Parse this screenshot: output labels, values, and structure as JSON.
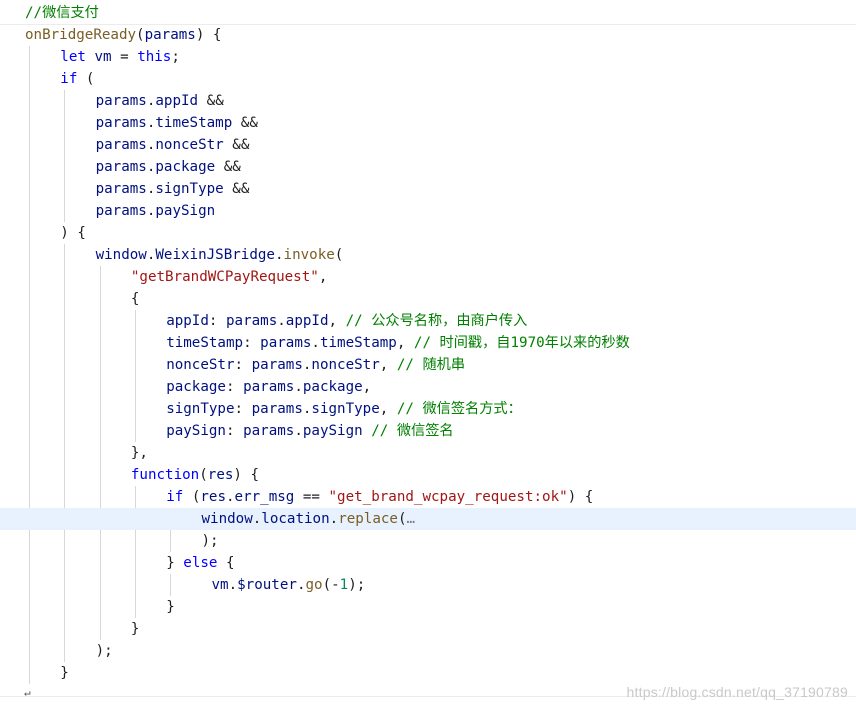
{
  "editor": {
    "colors": {
      "comment": "#008000",
      "keyword": "#0000ff",
      "identifier": "#001080",
      "function": "#795e26",
      "string": "#a31515",
      "number": "#098658",
      "punctuation": "#1e1e1e",
      "highlight_line": "#e8f2fe",
      "indent_guide": "#d7d7d7"
    },
    "lines": [
      {
        "indent": 0,
        "tokens": [
          {
            "text": "//微信支付",
            "type": "comment"
          }
        ]
      },
      {
        "indent": 0,
        "tokens": [
          {
            "text": "onBridgeReady",
            "type": "func"
          },
          {
            "text": "(",
            "type": "punct"
          },
          {
            "text": "params",
            "type": "ident"
          },
          {
            "text": ") {",
            "type": "punct"
          }
        ]
      },
      {
        "indent": 1,
        "tokens": [
          {
            "text": "let",
            "type": "keyword"
          },
          {
            "text": " ",
            "type": "punct"
          },
          {
            "text": "vm",
            "type": "ident"
          },
          {
            "text": " = ",
            "type": "punct"
          },
          {
            "text": "this",
            "type": "keyword"
          },
          {
            "text": ";",
            "type": "punct"
          }
        ]
      },
      {
        "indent": 1,
        "tokens": [
          {
            "text": "if",
            "type": "keyword"
          },
          {
            "text": " (",
            "type": "punct"
          }
        ]
      },
      {
        "indent": 2,
        "tokens": [
          {
            "text": "params",
            "type": "ident"
          },
          {
            "text": ".",
            "type": "punct"
          },
          {
            "text": "appId",
            "type": "ident"
          },
          {
            "text": " &&",
            "type": "punct"
          }
        ]
      },
      {
        "indent": 2,
        "tokens": [
          {
            "text": "params",
            "type": "ident"
          },
          {
            "text": ".",
            "type": "punct"
          },
          {
            "text": "timeStamp",
            "type": "ident"
          },
          {
            "text": " &&",
            "type": "punct"
          }
        ]
      },
      {
        "indent": 2,
        "tokens": [
          {
            "text": "params",
            "type": "ident"
          },
          {
            "text": ".",
            "type": "punct"
          },
          {
            "text": "nonceStr",
            "type": "ident"
          },
          {
            "text": " &&",
            "type": "punct"
          }
        ]
      },
      {
        "indent": 2,
        "tokens": [
          {
            "text": "params",
            "type": "ident"
          },
          {
            "text": ".",
            "type": "punct"
          },
          {
            "text": "package",
            "type": "ident"
          },
          {
            "text": " &&",
            "type": "punct"
          }
        ]
      },
      {
        "indent": 2,
        "tokens": [
          {
            "text": "params",
            "type": "ident"
          },
          {
            "text": ".",
            "type": "punct"
          },
          {
            "text": "signType",
            "type": "ident"
          },
          {
            "text": " &&",
            "type": "punct"
          }
        ]
      },
      {
        "indent": 2,
        "tokens": [
          {
            "text": "params",
            "type": "ident"
          },
          {
            "text": ".",
            "type": "punct"
          },
          {
            "text": "paySign",
            "type": "ident"
          }
        ]
      },
      {
        "indent": 1,
        "tokens": [
          {
            "text": ") {",
            "type": "punct"
          }
        ]
      },
      {
        "indent": 2,
        "tokens": [
          {
            "text": "window",
            "type": "ident"
          },
          {
            "text": ".",
            "type": "punct"
          },
          {
            "text": "WeixinJSBridge",
            "type": "ident"
          },
          {
            "text": ".",
            "type": "punct"
          },
          {
            "text": "invoke",
            "type": "func"
          },
          {
            "text": "(",
            "type": "punct"
          }
        ]
      },
      {
        "indent": 3,
        "tokens": [
          {
            "text": "\"getBrandWCPayRequest\"",
            "type": "string"
          },
          {
            "text": ",",
            "type": "punct"
          }
        ]
      },
      {
        "indent": 3,
        "tokens": [
          {
            "text": "{",
            "type": "punct"
          }
        ]
      },
      {
        "indent": 4,
        "tokens": [
          {
            "text": "appId",
            "type": "ident"
          },
          {
            "text": ": ",
            "type": "punct"
          },
          {
            "text": "params",
            "type": "ident"
          },
          {
            "text": ".",
            "type": "punct"
          },
          {
            "text": "appId",
            "type": "ident"
          },
          {
            "text": ", ",
            "type": "punct"
          },
          {
            "text": "// 公众号名称，由商户传入",
            "type": "comment"
          }
        ]
      },
      {
        "indent": 4,
        "tokens": [
          {
            "text": "timeStamp",
            "type": "ident"
          },
          {
            "text": ": ",
            "type": "punct"
          },
          {
            "text": "params",
            "type": "ident"
          },
          {
            "text": ".",
            "type": "punct"
          },
          {
            "text": "timeStamp",
            "type": "ident"
          },
          {
            "text": ", ",
            "type": "punct"
          },
          {
            "text": "// 时间戳，自1970年以来的秒数",
            "type": "comment"
          }
        ]
      },
      {
        "indent": 4,
        "tokens": [
          {
            "text": "nonceStr",
            "type": "ident"
          },
          {
            "text": ": ",
            "type": "punct"
          },
          {
            "text": "params",
            "type": "ident"
          },
          {
            "text": ".",
            "type": "punct"
          },
          {
            "text": "nonceStr",
            "type": "ident"
          },
          {
            "text": ", ",
            "type": "punct"
          },
          {
            "text": "// 随机串",
            "type": "comment"
          }
        ]
      },
      {
        "indent": 4,
        "tokens": [
          {
            "text": "package",
            "type": "ident"
          },
          {
            "text": ": ",
            "type": "punct"
          },
          {
            "text": "params",
            "type": "ident"
          },
          {
            "text": ".",
            "type": "punct"
          },
          {
            "text": "package",
            "type": "ident"
          },
          {
            "text": ",",
            "type": "punct"
          }
        ]
      },
      {
        "indent": 4,
        "tokens": [
          {
            "text": "signType",
            "type": "ident"
          },
          {
            "text": ": ",
            "type": "punct"
          },
          {
            "text": "params",
            "type": "ident"
          },
          {
            "text": ".",
            "type": "punct"
          },
          {
            "text": "signType",
            "type": "ident"
          },
          {
            "text": ", ",
            "type": "punct"
          },
          {
            "text": "// 微信签名方式：",
            "type": "comment"
          }
        ]
      },
      {
        "indent": 4,
        "tokens": [
          {
            "text": "paySign",
            "type": "ident"
          },
          {
            "text": ": ",
            "type": "punct"
          },
          {
            "text": "params",
            "type": "ident"
          },
          {
            "text": ".",
            "type": "punct"
          },
          {
            "text": "paySign",
            "type": "ident"
          },
          {
            "text": " ",
            "type": "punct"
          },
          {
            "text": "// 微信签名",
            "type": "comment"
          }
        ]
      },
      {
        "indent": 3,
        "tokens": [
          {
            "text": "},",
            "type": "punct"
          }
        ]
      },
      {
        "indent": 3,
        "tokens": [
          {
            "text": "function",
            "type": "keyword"
          },
          {
            "text": "(",
            "type": "punct"
          },
          {
            "text": "res",
            "type": "ident"
          },
          {
            "text": ") {",
            "type": "punct"
          }
        ]
      },
      {
        "indent": 4,
        "tokens": [
          {
            "text": "if",
            "type": "keyword"
          },
          {
            "text": " (",
            "type": "punct"
          },
          {
            "text": "res",
            "type": "ident"
          },
          {
            "text": ".",
            "type": "punct"
          },
          {
            "text": "err_msg",
            "type": "ident"
          },
          {
            "text": " == ",
            "type": "punct"
          },
          {
            "text": "\"get_brand_wcpay_request:ok\"",
            "type": "string"
          },
          {
            "text": ") {",
            "type": "punct"
          }
        ]
      },
      {
        "indent": 5,
        "highlight": true,
        "tokens": [
          {
            "text": "window",
            "type": "ident"
          },
          {
            "text": ".",
            "type": "punct"
          },
          {
            "text": "location",
            "type": "ident"
          },
          {
            "text": ".",
            "type": "punct"
          },
          {
            "text": "replace",
            "type": "func"
          },
          {
            "text": "(",
            "type": "punct"
          },
          {
            "text": "…",
            "type": "ellipsis"
          }
        ]
      },
      {
        "indent": 5,
        "tokens": [
          {
            "text": ");",
            "type": "punct"
          }
        ]
      },
      {
        "indent": 4,
        "tokens": [
          {
            "text": "} ",
            "type": "punct"
          },
          {
            "text": "else",
            "type": "keyword"
          },
          {
            "text": " {",
            "type": "punct"
          }
        ]
      },
      {
        "indent": 5,
        "shift": 1,
        "tokens": [
          {
            "text": "vm",
            "type": "ident"
          },
          {
            "text": ".",
            "type": "punct"
          },
          {
            "text": "$router",
            "type": "ident"
          },
          {
            "text": ".",
            "type": "punct"
          },
          {
            "text": "go",
            "type": "func"
          },
          {
            "text": "(-",
            "type": "punct"
          },
          {
            "text": "1",
            "type": "number"
          },
          {
            "text": ");",
            "type": "punct"
          }
        ]
      },
      {
        "indent": 4,
        "tokens": [
          {
            "text": "}",
            "type": "punct"
          }
        ]
      },
      {
        "indent": 3,
        "tokens": [
          {
            "text": "}",
            "type": "punct"
          }
        ]
      },
      {
        "indent": 2,
        "tokens": [
          {
            "text": ");",
            "type": "punct"
          }
        ]
      },
      {
        "indent": 1,
        "tokens": [
          {
            "text": "}",
            "type": "punct"
          }
        ]
      }
    ]
  },
  "watermark": "https://blog.csdn.net/qq_37190789"
}
